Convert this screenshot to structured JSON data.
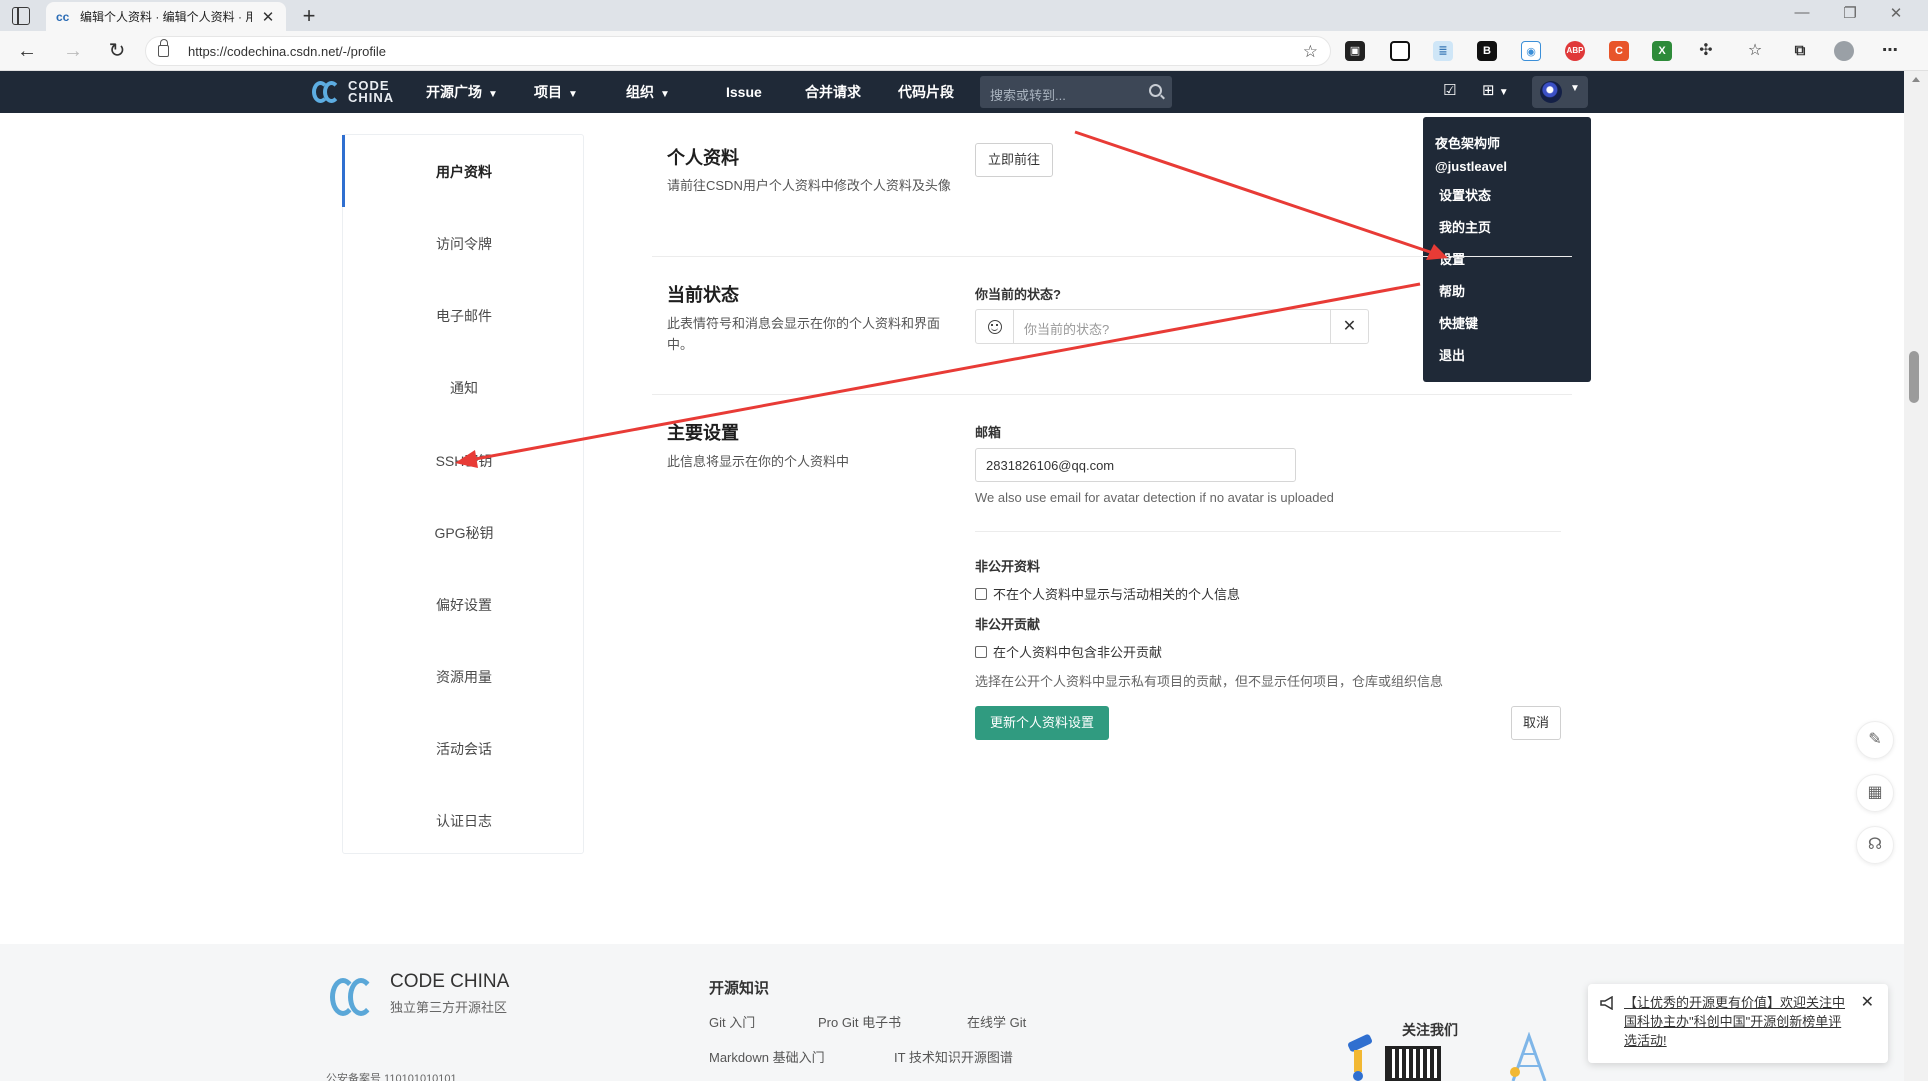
{
  "browser": {
    "tab_title": "编辑个人资料 · 编辑个人资料 · 用",
    "url": "https://codechina.csdn.net/-/profile",
    "extensions": [
      "collections-icon",
      "square-icon",
      "reader-icon",
      "b-ext-icon",
      "bot-icon",
      "abp-icon",
      "c-ext-icon",
      "excel-icon",
      "puzzle-icon",
      "favorites-icon",
      "collections2-icon",
      "profile-icon",
      "more-icon"
    ]
  },
  "header": {
    "logo_line1": "CODE",
    "logo_line2": "CHINA",
    "nav": [
      "开源广场",
      "项目",
      "组织",
      "Issue",
      "合并请求",
      "代码片段"
    ],
    "search_placeholder": "搜索或转到..."
  },
  "user_menu": {
    "name": "夜色架构师",
    "handle": "@justleavel",
    "items": [
      "设置状态",
      "我的主页",
      "设置",
      "帮助",
      "快捷键",
      "退出"
    ]
  },
  "sidebar": {
    "items": [
      "用户资料",
      "访问令牌",
      "电子邮件",
      "通知",
      "SSH密钥",
      "GPG秘钥",
      "偏好设置",
      "资源用量",
      "活动会话",
      "认证日志"
    ]
  },
  "profile_section": {
    "title": "个人资料",
    "desc": "请前往CSDN用户个人资料中修改个人资料及头像",
    "goto_button": "立即前往"
  },
  "status_section": {
    "title": "当前状态",
    "desc": "此表情符号和消息会显示在你的个人资料和界面中。",
    "field_label": "你当前的状态?",
    "placeholder": "你当前的状态?"
  },
  "main_section": {
    "title": "主要设置",
    "desc": "此信息将显示在你的个人资料中",
    "email_label": "邮箱",
    "email_value": "2831826106@qq.com",
    "email_hint": "We also use email for avatar detection if no avatar is uploaded",
    "private_profile_label": "非公开资料",
    "private_profile_checkbox": "不在个人资料中显示与活动相关的个人信息",
    "private_contrib_label": "非公开贡献",
    "private_contrib_checkbox": "在个人资料中包含非公开贡献",
    "private_contrib_hint": "选择在公开个人资料中显示私有项目的贡献，但不显示任何项目，仓库或组织信息",
    "update_button": "更新个人资料设置",
    "cancel_button": "取消"
  },
  "footer": {
    "logo_title": "CODE CHINA",
    "logo_sub": "独立第三方开源社区",
    "icp": "公安备案号 110101010101",
    "col_title": "开源知识",
    "links": [
      "Git 入门",
      "Pro Git 电子书",
      "在线学 Git",
      "Markdown 基础入门",
      "IT 技术知识开源图谱"
    ],
    "follow": "关注我们"
  },
  "notice": {
    "text": "【让优秀的开源更有价值】欢迎关注中国科协主办\"科创中国\"开源创新榜单评选活动!"
  },
  "colors": {
    "header_bg": "#1f2937",
    "primary_button": "#309b80",
    "annotation_arrow": "#e83b36",
    "active_bar": "#2f6fd0"
  }
}
